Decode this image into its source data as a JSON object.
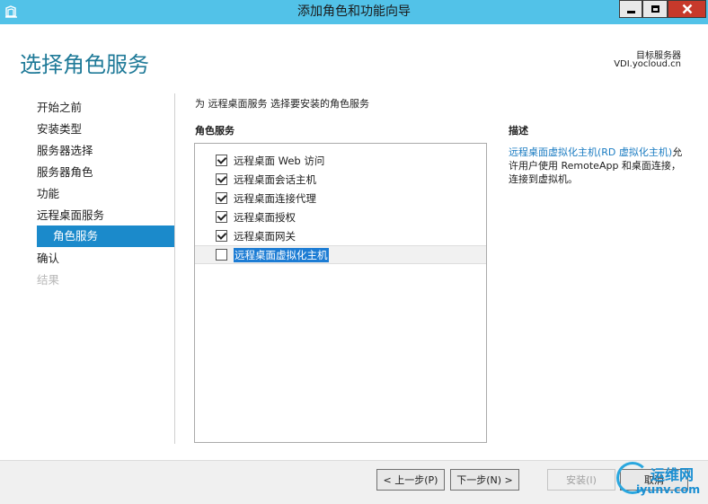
{
  "window": {
    "title": "添加角色和功能向导",
    "icon": "server-manager-icon"
  },
  "header": {
    "page_title": "选择角色服务",
    "target_label": "目标服务器",
    "target_value": "VDI.yocloud.cn"
  },
  "nav": {
    "items": [
      {
        "label": "开始之前"
      },
      {
        "label": "安装类型"
      },
      {
        "label": "服务器选择"
      },
      {
        "label": "服务器角色"
      },
      {
        "label": "功能"
      },
      {
        "label": "远程桌面服务"
      },
      {
        "label": "角色服务",
        "active": true
      },
      {
        "label": "确认"
      },
      {
        "label": "结果",
        "disabled": true
      }
    ]
  },
  "content": {
    "instruction": "为 远程桌面服务 选择要安装的角色服务",
    "roles_header": "角色服务",
    "roles": [
      {
        "label": "远程桌面 Web 访问",
        "checked": true
      },
      {
        "label": "远程桌面会话主机",
        "checked": true
      },
      {
        "label": "远程桌面连接代理",
        "checked": true
      },
      {
        "label": "远程桌面授权",
        "checked": true
      },
      {
        "label": "远程桌面网关",
        "checked": true
      },
      {
        "label": "远程桌面虚拟化主机",
        "checked": false,
        "selected": true
      }
    ],
    "description_header": "描述",
    "description_link": "远程桌面虚拟化主机(RD 虚拟化主机)",
    "description_rest": "允许用户使用 RemoteApp 和桌面连接，连接到虚拟机。"
  },
  "footer": {
    "prev": "< 上一步(P)",
    "next": "下一步(N) >",
    "install": "安装(I)",
    "cancel": "取消"
  },
  "watermark": {
    "cn": "运维网",
    "en": "iyunv.com"
  },
  "colors": {
    "titlebar": "#52c2e8",
    "accent": "#1b8acb",
    "title_text": "#1f7a98",
    "close_button": "#c7392b"
  }
}
